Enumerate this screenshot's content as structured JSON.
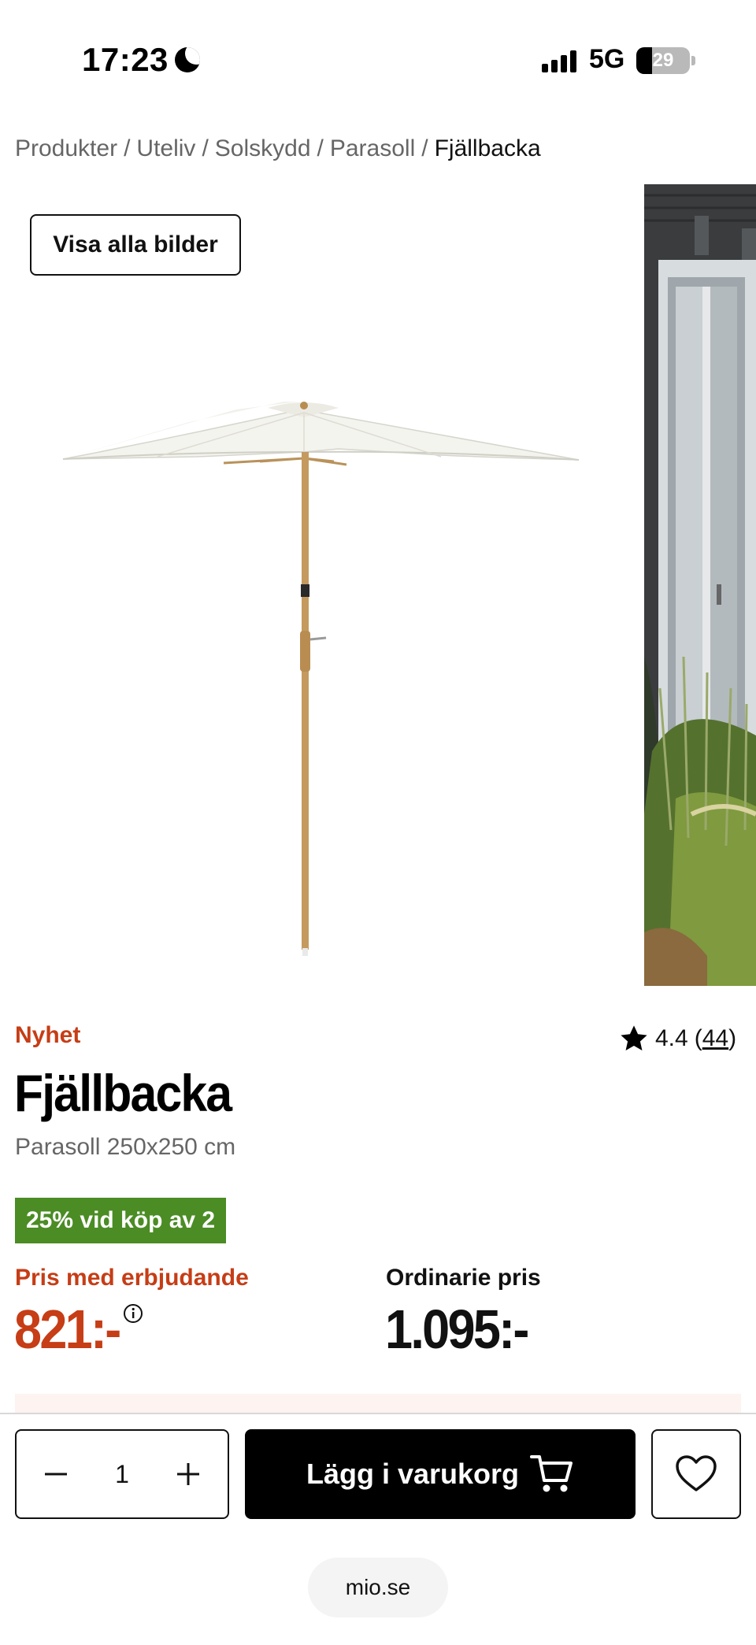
{
  "status_bar": {
    "time": "17:23",
    "network": "5G",
    "battery": "29",
    "battery_level": 0.29
  },
  "breadcrumb": {
    "items": [
      "Produkter",
      "Uteliv",
      "Solskydd",
      "Parasoll"
    ],
    "separator": "/",
    "current": "Fjällbacka"
  },
  "gallery": {
    "show_all_label": "Visa alla bilder"
  },
  "product": {
    "badge": "Nyhet",
    "rating": "4.4",
    "rating_count": "44",
    "title": "Fjällbacka",
    "subtitle": "Parasoll 250x250 cm",
    "promo": "25% vid köp av 2",
    "offer_label": "Pris med erbjudande",
    "offer_price": "821:-",
    "regular_label": "Ordinarie pris",
    "regular_price": "1.095:-"
  },
  "bottom_bar": {
    "quantity": "1",
    "add_to_cart": "Lägg i varukorg"
  },
  "browser": {
    "url": "mio.se"
  },
  "colors": {
    "accent": "#c63d16",
    "promo_green": "#4b8c25",
    "button": "#000000"
  }
}
